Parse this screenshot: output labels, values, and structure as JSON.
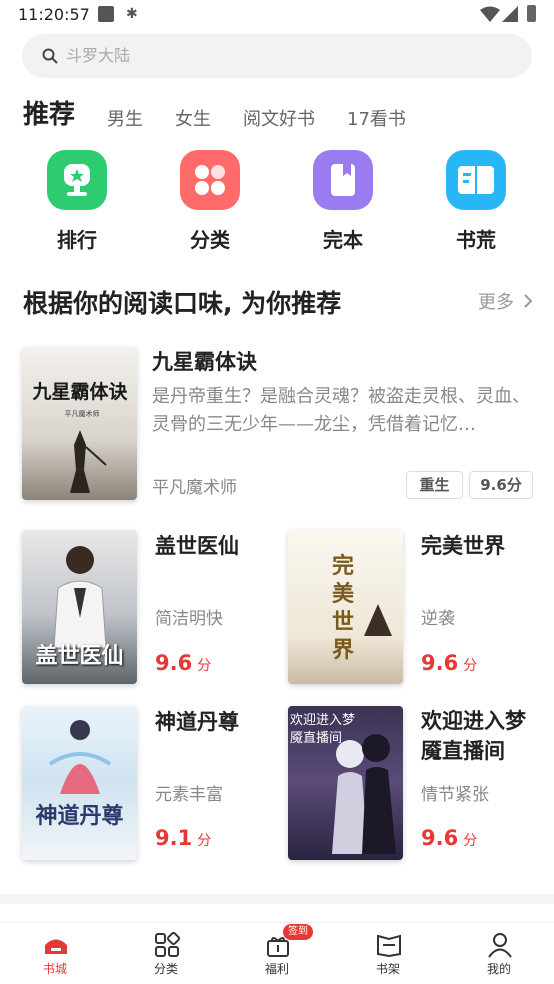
{
  "status_bar": {
    "time": "11:20:57"
  },
  "search": {
    "placeholder": "斗罗大陆"
  },
  "tabs": {
    "active": "推荐",
    "items": [
      "男生",
      "女生",
      "阅文好书",
      "17看书"
    ]
  },
  "categories": [
    {
      "label": "排行",
      "icon": "trophy-icon",
      "color": "#2ecc71"
    },
    {
      "label": "分类",
      "icon": "grid-icon",
      "color": "#ff6b6b"
    },
    {
      "label": "完本",
      "icon": "book-icon",
      "color": "#9b7cf0"
    },
    {
      "label": "书荒",
      "icon": "open-book-icon",
      "color": "#29b6f6"
    }
  ],
  "section": {
    "title": "根据你的阅读口味, 为你推荐",
    "more": "更多"
  },
  "featured": {
    "title": "九星霸体诀",
    "description": "是丹帝重生？是融合灵魂？被盗走灵根、灵血、灵骨的三无少年——龙尘，凭借着记忆…",
    "author": "平凡魔术师",
    "tag": "重生",
    "score": "9.6分",
    "cover_text": "九星霸体诀",
    "cover_author": "平凡魔术师"
  },
  "books": [
    {
      "title": "盖世医仙",
      "tag": "简洁明快",
      "score": "9.6",
      "unit": "分",
      "cover_text": "盖世医仙"
    },
    {
      "title": "完美世界",
      "tag": "逆袭",
      "score": "9.6",
      "unit": "分",
      "cover_text": "完美世界"
    },
    {
      "title": "神道丹尊",
      "tag": "元素丰富",
      "score": "9.1",
      "unit": "分",
      "cover_text": "神道丹尊"
    },
    {
      "title": "欢迎进入梦魇直播间",
      "tag": "情节紧张",
      "score": "9.6",
      "unit": "分",
      "cover_text": "欢迎进入梦魇直播间"
    }
  ],
  "bottom_nav": {
    "items": [
      {
        "label": "书城",
        "icon": "home-icon",
        "active": true
      },
      {
        "label": "分类",
        "icon": "category-icon"
      },
      {
        "label": "福利",
        "icon": "gift-icon"
      },
      {
        "label": "书架",
        "icon": "bookshelf-icon"
      },
      {
        "label": "我的",
        "icon": "user-icon"
      }
    ],
    "badge": "签到"
  },
  "colors": {
    "accent": "#e53935"
  }
}
